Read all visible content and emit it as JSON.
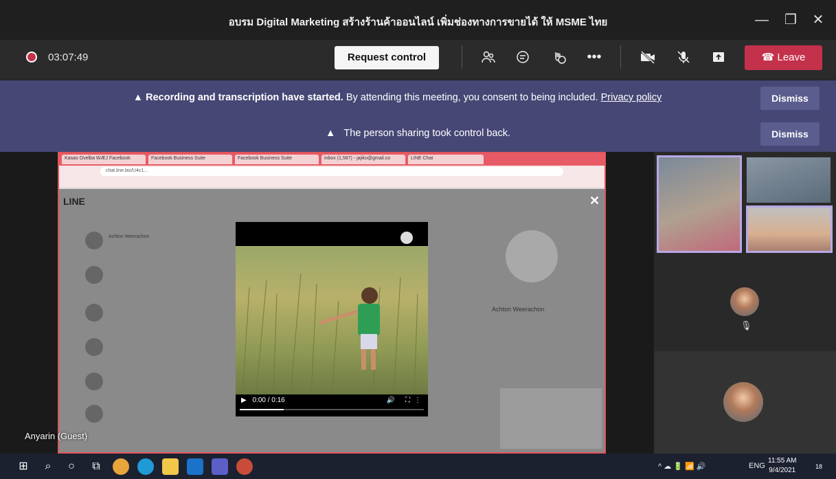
{
  "window": {
    "title": "อบรม Digital Marketing สร้างร้านค้าออนไลน์ เพิ่มช่องทางการขายได้ ให้ MSME ไทย",
    "minimize": "—",
    "maximize": "❐",
    "close": "✕"
  },
  "toolbar": {
    "timer": "03:07:49",
    "request_control": "Request control",
    "leave": "Leave",
    "icons": [
      "people-icon",
      "chat-icon",
      "reactions-icon",
      "more-icon",
      "camera-off-icon",
      "mic-off-icon",
      "share-icon"
    ]
  },
  "banners": [
    {
      "bold": "Recording and transcription have started.",
      "text": "By attending this meeting, you consent to being included.",
      "link": "Privacy policy",
      "dismiss": "Dismiss"
    },
    {
      "bold": "",
      "text": "The person sharing took control back.",
      "link": "",
      "dismiss": "Dismiss"
    }
  ],
  "share": {
    "browser_tabs": [
      "Kasao Ovelba WÆJ Facebook",
      "Facebook Business Suite",
      "Facebook Business Suite",
      "inbox (1,587) - jajiko@gmail.co",
      "LINE Chat"
    ],
    "address": "chat.line.biz/U4c1...",
    "app_logo": "LINE",
    "contacts": [
      "Achton Weerachon",
      "",
      "",
      "",
      "",
      ""
    ],
    "profile_name": "Achton Weerachon",
    "video": {
      "time": "0:00 / 0:16",
      "progress": 0.24
    }
  },
  "guest_label": "Anyarin (Guest)",
  "taskbar": {
    "lang": "ENG",
    "time": "11:55 AM",
    "date": "9/4/2021",
    "notif_count": "18"
  }
}
